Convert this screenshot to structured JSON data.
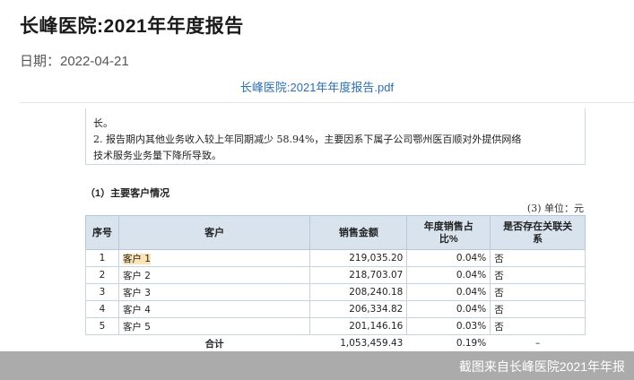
{
  "page": {
    "title": "长峰医院:2021年年度报告",
    "date_line": "日期：2022-04-21",
    "pdf_link_text": "长峰医院:2021年年度报告.pdf"
  },
  "document": {
    "note_lines": [
      "长。",
      "2. 报告期内其他业务收入较上年同期减少 58.94%，主要因系下属子公司鄂州医百顺对外提供网络",
      "技术服务业务量下降所导致。"
    ],
    "section_heading": "（1）主要客户情况",
    "unit_line": "(3) 单位：元",
    "table": {
      "headers": {
        "idx": "序号",
        "customer": "客户",
        "amount": "销售金额",
        "ratio_line1": "年度销售占",
        "ratio_line2": "比%",
        "related_line1": "是否存在关联关",
        "related_line2": "系"
      },
      "rows": [
        {
          "idx": "1",
          "customer": "客户 1",
          "amount": "219,035.20",
          "ratio": "0.04%",
          "related": "否"
        },
        {
          "idx": "2",
          "customer": "客户 2",
          "amount": "218,703.07",
          "ratio": "0.04%",
          "related": "否"
        },
        {
          "idx": "3",
          "customer": "客户 3",
          "amount": "208,240.18",
          "ratio": "0.04%",
          "related": "否"
        },
        {
          "idx": "4",
          "customer": "客户 4",
          "amount": "206,334.82",
          "ratio": "0.04%",
          "related": "否"
        },
        {
          "idx": "5",
          "customer": "客户 5",
          "amount": "201,146.16",
          "ratio": "0.03%",
          "related": "否"
        }
      ],
      "total": {
        "label": "合计",
        "amount": "1,053,459.43",
        "ratio": "0.19%",
        "related": "–"
      }
    }
  },
  "watermark": {
    "text": "截图来自长峰医院2021年年报"
  }
}
